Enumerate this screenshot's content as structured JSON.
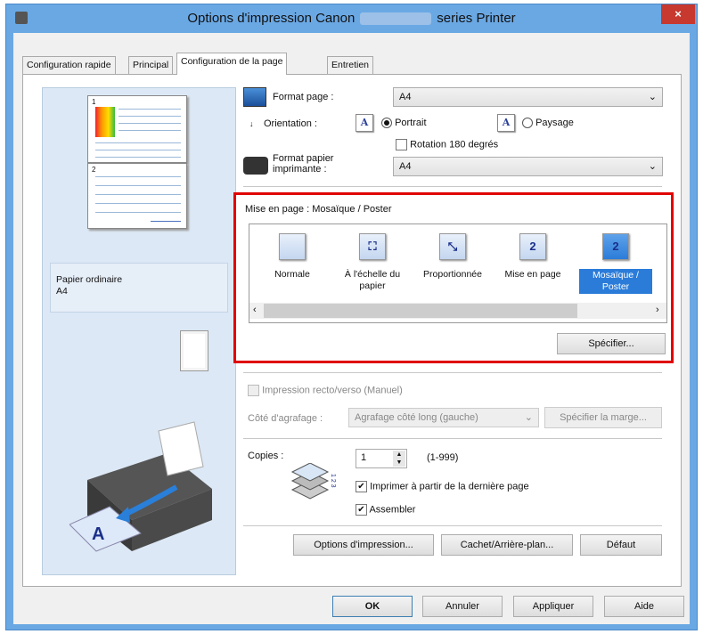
{
  "window": {
    "title_prefix": "Options d'impression Canon",
    "title_suffix": "series Printer",
    "close": "×"
  },
  "tabs": [
    {
      "label": "Configuration rapide"
    },
    {
      "label": "Principal"
    },
    {
      "label": "Configuration de la page"
    },
    {
      "label": "Entretien"
    }
  ],
  "preview": {
    "paper_type": "Papier ordinaire",
    "paper_size": "A4",
    "page_numbers": [
      "1",
      "2"
    ]
  },
  "page_size": {
    "label": "Format page :",
    "value": "A4"
  },
  "orientation": {
    "label": "Orientation :",
    "portrait": "Portrait",
    "landscape": "Paysage",
    "selected": "Portrait",
    "icon_glyph": "A"
  },
  "rotation": {
    "label": "Rotation 180 degrés",
    "checked": false
  },
  "printer_paper": {
    "label": "Format papier imprimante :",
    "value": "A4"
  },
  "layout": {
    "label": "Mise en page :",
    "current": "Mosaïque / Poster",
    "items": [
      {
        "label": "Normale",
        "glyph": ""
      },
      {
        "label": "À l'échelle du papier",
        "glyph": "⛶"
      },
      {
        "label": "Proportionnée",
        "glyph": "⤡"
      },
      {
        "label": "Mise en page",
        "glyph": "2"
      },
      {
        "label": "Mosaïque / Poster",
        "glyph": "2",
        "selected": true
      }
    ],
    "specify": "Spécifier..."
  },
  "duplex": {
    "label": "Impression recto/verso (Manuel)",
    "checked": false,
    "staple_label": "Côté d'agrafage :",
    "staple_value": "Agrafage côté long (gauche)",
    "margin_button": "Spécifier la marge..."
  },
  "copies": {
    "label": "Copies :",
    "value": "1",
    "range": "(1-999)",
    "reverse": "Imprimer à partir de la dernière page",
    "collate": "Assembler",
    "order_digits": "1 2 3"
  },
  "panel_buttons": {
    "print_options": "Options d'impression...",
    "stamp": "Cachet/Arrière-plan...",
    "defaults": "Défaut"
  },
  "dialog_buttons": {
    "ok": "OK",
    "cancel": "Annuler",
    "apply": "Appliquer",
    "help": "Aide"
  },
  "colors": {
    "titlebar": "#6aa8e4",
    "highlight": "#e00000",
    "selection": "#2b7cd9"
  }
}
